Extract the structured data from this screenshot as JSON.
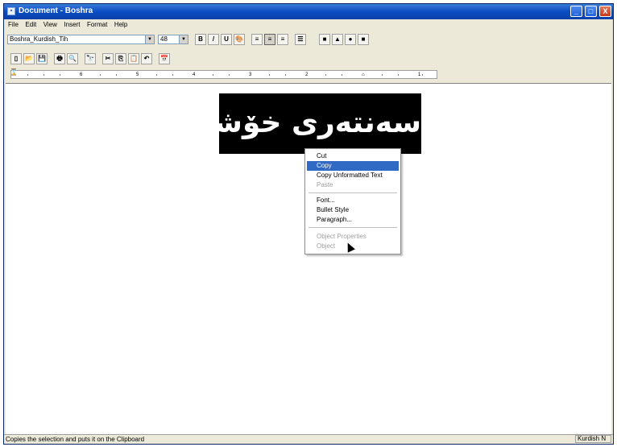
{
  "window": {
    "title": "Document - Boshra",
    "icon": "document-icon",
    "controls": {
      "minimize": "_",
      "maximize": "□",
      "close": "X"
    }
  },
  "menubar": {
    "items": [
      {
        "label": "File"
      },
      {
        "label": "Edit"
      },
      {
        "label": "View"
      },
      {
        "label": "Insert"
      },
      {
        "label": "Format"
      },
      {
        "label": "Help"
      }
    ]
  },
  "format_toolbar": {
    "font_value": "Boshra_Kurdish_Tih",
    "size_value": "48",
    "script_value": "",
    "buttons": {
      "bold": "B",
      "italic": "/",
      "underline": "U",
      "color": "🎨",
      "align_left": "≡",
      "align_center": "≡",
      "align_right": "≡",
      "bullets": "☰",
      "extra1": "■",
      "extra2": "▲",
      "extra3": "●",
      "extra4": "■"
    }
  },
  "standard_toolbar": {
    "buttons": {
      "new": "▯",
      "open": "📂",
      "save": "💾",
      "print": "🖶",
      "preview": "🔍",
      "find": "🔭",
      "cut": "✂",
      "copy": "⎘",
      "paste": "📋",
      "undo": "↶",
      "date": "📅"
    }
  },
  "ruler": {
    "labels": [
      "6",
      "5",
      "4",
      "3",
      "2",
      "1"
    ]
  },
  "document": {
    "selected_text": "سەنتەری خۆشی"
  },
  "context_menu": {
    "items": [
      {
        "label": "Cut",
        "state": "normal"
      },
      {
        "label": "Copy",
        "state": "highlighted"
      },
      {
        "label": "Copy Unformatted Text",
        "state": "normal"
      },
      {
        "label": "Paste",
        "state": "disabled"
      },
      {
        "label": "Font...",
        "state": "normal"
      },
      {
        "label": "Bullet Style",
        "state": "normal"
      },
      {
        "label": "Paragraph...",
        "state": "normal"
      },
      {
        "label": "Object Properties",
        "state": "disabled"
      },
      {
        "label": "Object",
        "state": "disabled"
      }
    ]
  },
  "statusbar": {
    "text": "Copies the selection and puts it on the Clipboard",
    "language": "Kurdish  N"
  }
}
